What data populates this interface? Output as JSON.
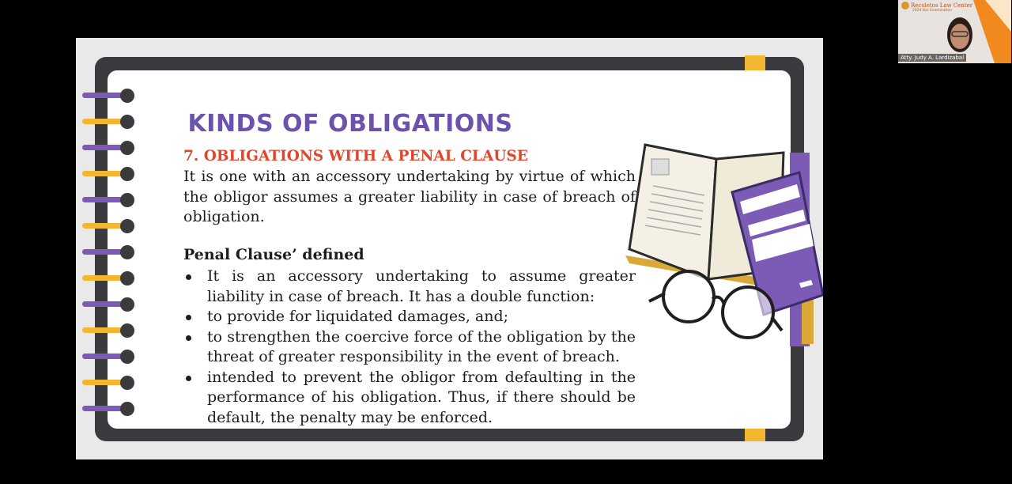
{
  "slide": {
    "title": "KINDS OF OBLIGATIONS",
    "subtitle": "7. OBLIGATIONS WITH A PENAL CLAUSE",
    "intro": "It is one with an accessory undertaking by virtue of which the obligor assumes a greater liability in case of breach of obligation.",
    "definition_heading": "Penal Clause’ defined",
    "bullets": [
      "It is an accessory undertaking to assume greater liability in case of breach. It has a double function:",
      "to provide for liquidated damages, and;",
      "to strengthen the coercive force of the obligation by the threat of greater responsibility in the event of breach.",
      "intended to prevent the obligor from defaulting in the performance of his obligation. Thus, if there should be default, the penalty may be enforced."
    ]
  },
  "webcam": {
    "logo_text": "Recoletos Law Center",
    "logo_subtext": "2024 Bar Examination",
    "participant_name": "Atty. Judy A. Lardizabal"
  },
  "colors": {
    "title": "#6b52ad",
    "subtitle": "#e0462b",
    "accent_yellow": "#f2b630",
    "accent_purple": "#7b5bb5",
    "frame": "#3b3b3f"
  }
}
